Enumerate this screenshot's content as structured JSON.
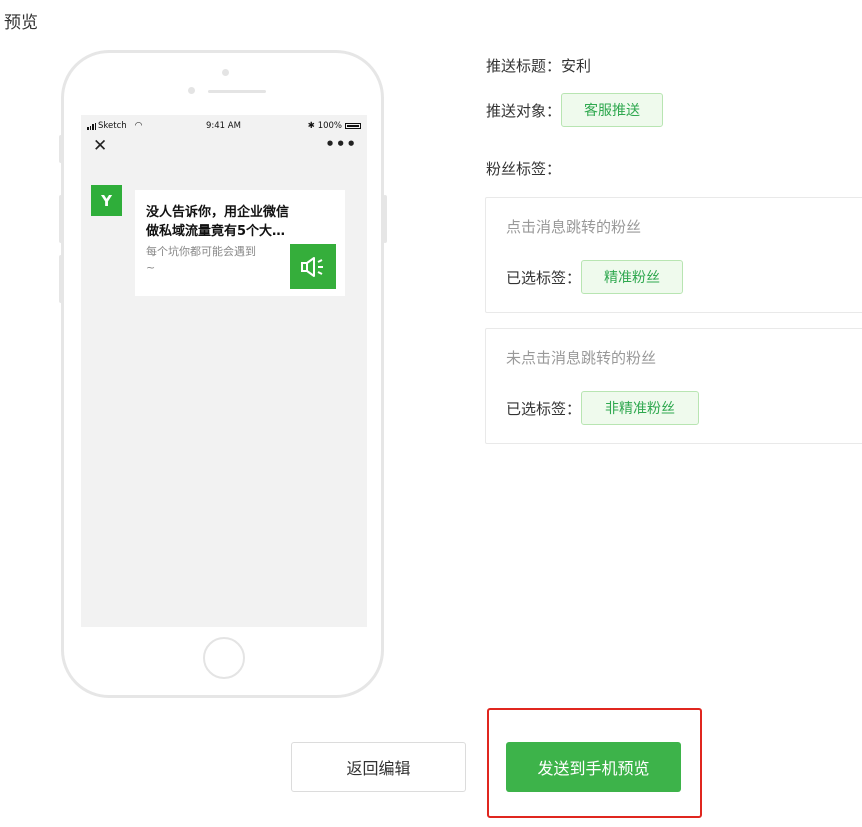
{
  "page": {
    "title": "预览"
  },
  "phone": {
    "status": {
      "carrier": "Sketch",
      "time": "9:41 AM",
      "battery": "100%"
    },
    "close_icon": "close-icon",
    "more_icon": "more-icon",
    "message": {
      "avatar_letter": "Y",
      "title_line1": "没人告诉你，用企业微信",
      "title_line2": "做私域流量竟有5个大…",
      "desc_line1": "每个坑你都可能会遇到",
      "desc_line2": "~"
    }
  },
  "info": {
    "push_title_label": "推送标题：",
    "push_title_value": "安利",
    "push_target_label": "推送对象：",
    "push_target_tag": "客服推送",
    "fan_tags_label": "粉丝标签："
  },
  "panels": [
    {
      "title": "点击消息跳转的粉丝",
      "selected_label": "已选标签：",
      "tag": "精准粉丝"
    },
    {
      "title": "未点击消息跳转的粉丝",
      "selected_label": "已选标签：",
      "tag": "非精准粉丝"
    }
  ],
  "buttons": {
    "back": "返回编辑",
    "send": "发送到手机预览"
  },
  "colors": {
    "accent": "#3db34a",
    "highlight": "#e0261f",
    "tag_bg": "#effaed",
    "tag_text": "#2fa84f"
  }
}
